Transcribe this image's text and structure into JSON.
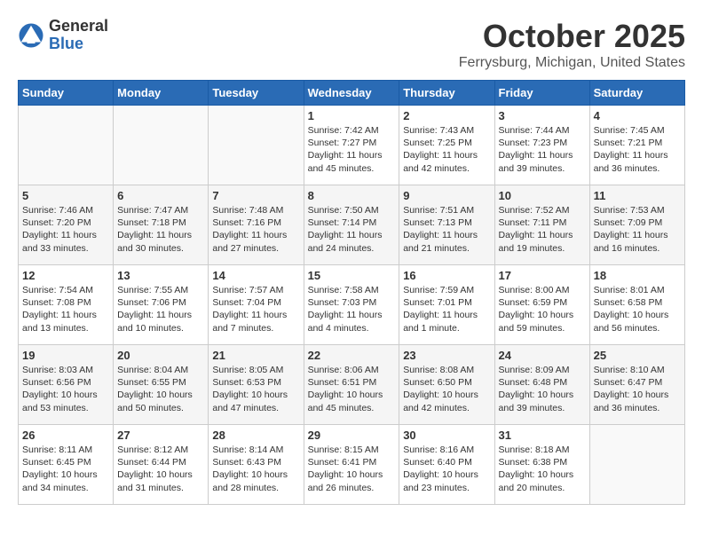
{
  "logo": {
    "general": "General",
    "blue": "Blue"
  },
  "title": "October 2025",
  "location": "Ferrysburg, Michigan, United States",
  "weekdays": [
    "Sunday",
    "Monday",
    "Tuesday",
    "Wednesday",
    "Thursday",
    "Friday",
    "Saturday"
  ],
  "weeks": [
    [
      {
        "day": "",
        "info": ""
      },
      {
        "day": "",
        "info": ""
      },
      {
        "day": "",
        "info": ""
      },
      {
        "day": "1",
        "info": "Sunrise: 7:42 AM\nSunset: 7:27 PM\nDaylight: 11 hours and 45 minutes."
      },
      {
        "day": "2",
        "info": "Sunrise: 7:43 AM\nSunset: 7:25 PM\nDaylight: 11 hours and 42 minutes."
      },
      {
        "day": "3",
        "info": "Sunrise: 7:44 AM\nSunset: 7:23 PM\nDaylight: 11 hours and 39 minutes."
      },
      {
        "day": "4",
        "info": "Sunrise: 7:45 AM\nSunset: 7:21 PM\nDaylight: 11 hours and 36 minutes."
      }
    ],
    [
      {
        "day": "5",
        "info": "Sunrise: 7:46 AM\nSunset: 7:20 PM\nDaylight: 11 hours and 33 minutes."
      },
      {
        "day": "6",
        "info": "Sunrise: 7:47 AM\nSunset: 7:18 PM\nDaylight: 11 hours and 30 minutes."
      },
      {
        "day": "7",
        "info": "Sunrise: 7:48 AM\nSunset: 7:16 PM\nDaylight: 11 hours and 27 minutes."
      },
      {
        "day": "8",
        "info": "Sunrise: 7:50 AM\nSunset: 7:14 PM\nDaylight: 11 hours and 24 minutes."
      },
      {
        "day": "9",
        "info": "Sunrise: 7:51 AM\nSunset: 7:13 PM\nDaylight: 11 hours and 21 minutes."
      },
      {
        "day": "10",
        "info": "Sunrise: 7:52 AM\nSunset: 7:11 PM\nDaylight: 11 hours and 19 minutes."
      },
      {
        "day": "11",
        "info": "Sunrise: 7:53 AM\nSunset: 7:09 PM\nDaylight: 11 hours and 16 minutes."
      }
    ],
    [
      {
        "day": "12",
        "info": "Sunrise: 7:54 AM\nSunset: 7:08 PM\nDaylight: 11 hours and 13 minutes."
      },
      {
        "day": "13",
        "info": "Sunrise: 7:55 AM\nSunset: 7:06 PM\nDaylight: 11 hours and 10 minutes."
      },
      {
        "day": "14",
        "info": "Sunrise: 7:57 AM\nSunset: 7:04 PM\nDaylight: 11 hours and 7 minutes."
      },
      {
        "day": "15",
        "info": "Sunrise: 7:58 AM\nSunset: 7:03 PM\nDaylight: 11 hours and 4 minutes."
      },
      {
        "day": "16",
        "info": "Sunrise: 7:59 AM\nSunset: 7:01 PM\nDaylight: 11 hours and 1 minute."
      },
      {
        "day": "17",
        "info": "Sunrise: 8:00 AM\nSunset: 6:59 PM\nDaylight: 10 hours and 59 minutes."
      },
      {
        "day": "18",
        "info": "Sunrise: 8:01 AM\nSunset: 6:58 PM\nDaylight: 10 hours and 56 minutes."
      }
    ],
    [
      {
        "day": "19",
        "info": "Sunrise: 8:03 AM\nSunset: 6:56 PM\nDaylight: 10 hours and 53 minutes."
      },
      {
        "day": "20",
        "info": "Sunrise: 8:04 AM\nSunset: 6:55 PM\nDaylight: 10 hours and 50 minutes."
      },
      {
        "day": "21",
        "info": "Sunrise: 8:05 AM\nSunset: 6:53 PM\nDaylight: 10 hours and 47 minutes."
      },
      {
        "day": "22",
        "info": "Sunrise: 8:06 AM\nSunset: 6:51 PM\nDaylight: 10 hours and 45 minutes."
      },
      {
        "day": "23",
        "info": "Sunrise: 8:08 AM\nSunset: 6:50 PM\nDaylight: 10 hours and 42 minutes."
      },
      {
        "day": "24",
        "info": "Sunrise: 8:09 AM\nSunset: 6:48 PM\nDaylight: 10 hours and 39 minutes."
      },
      {
        "day": "25",
        "info": "Sunrise: 8:10 AM\nSunset: 6:47 PM\nDaylight: 10 hours and 36 minutes."
      }
    ],
    [
      {
        "day": "26",
        "info": "Sunrise: 8:11 AM\nSunset: 6:45 PM\nDaylight: 10 hours and 34 minutes."
      },
      {
        "day": "27",
        "info": "Sunrise: 8:12 AM\nSunset: 6:44 PM\nDaylight: 10 hours and 31 minutes."
      },
      {
        "day": "28",
        "info": "Sunrise: 8:14 AM\nSunset: 6:43 PM\nDaylight: 10 hours and 28 minutes."
      },
      {
        "day": "29",
        "info": "Sunrise: 8:15 AM\nSunset: 6:41 PM\nDaylight: 10 hours and 26 minutes."
      },
      {
        "day": "30",
        "info": "Sunrise: 8:16 AM\nSunset: 6:40 PM\nDaylight: 10 hours and 23 minutes."
      },
      {
        "day": "31",
        "info": "Sunrise: 8:18 AM\nSunset: 6:38 PM\nDaylight: 10 hours and 20 minutes."
      },
      {
        "day": "",
        "info": ""
      }
    ]
  ]
}
